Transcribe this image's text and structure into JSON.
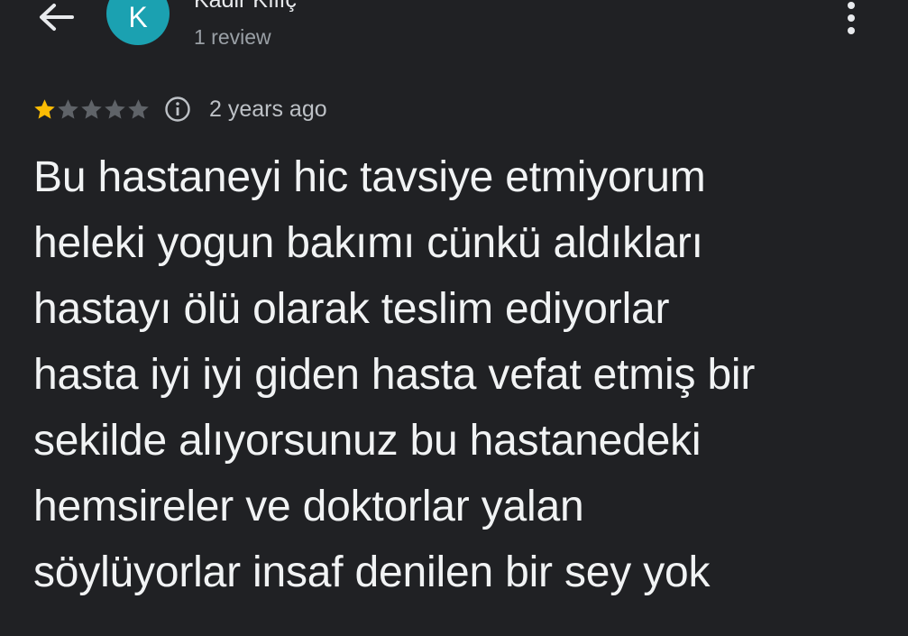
{
  "header": {
    "back_icon": "arrow-back-icon",
    "avatar_letter": "K",
    "avatar_color": "#1ba1b1",
    "author_name": "Kadir Kılıç",
    "review_count": "1 review",
    "more_icon": "more-vertical-icon"
  },
  "review": {
    "rating": 1,
    "max_rating": 5,
    "star_filled_color": "#fbbc04",
    "star_empty_color": "#5f6368",
    "info_icon": "info-icon",
    "time": "2 years ago",
    "text": "Bu hastaneyi hic tavsiye etmiyorum\nheleki yogun bakımı cünkü aldıkları\nhastayı ölü olarak teslim ediyorlar\nhasta iyi iyi giden hasta vefat etmiş bir\nsekilde alıyorsunuz bu hastanedeki\nhemsireler ve doktorlar yalan\nsöylüyorlar  insaf denilen bir sey yok"
  }
}
